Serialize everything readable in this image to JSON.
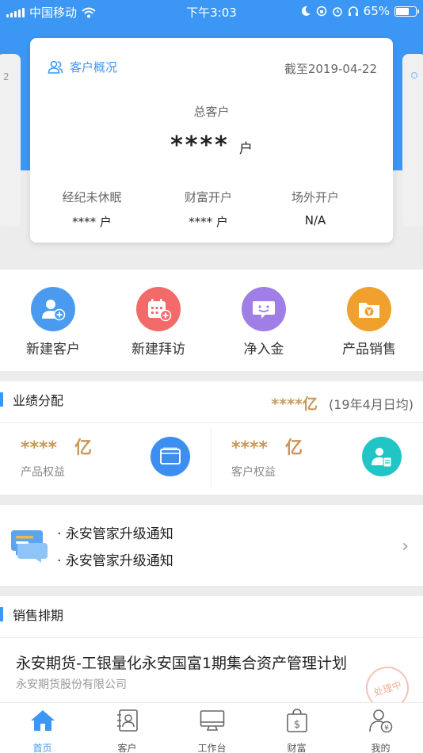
{
  "status_bar": {
    "carrier": "中国移动",
    "time": "下午3:03",
    "battery": "65%",
    "battery_level": 0.65
  },
  "side_cards": {
    "left_peek": "2"
  },
  "overview": {
    "title": "客户概况",
    "date": "截至2019-04-22",
    "total_label": "总客户",
    "total_value": "****",
    "total_unit": "户",
    "stats": [
      {
        "label": "经纪未休眠",
        "value": "**** 户"
      },
      {
        "label": "财富开户",
        "value": "**** 户"
      },
      {
        "label": "场外开户",
        "value": "N/A"
      }
    ]
  },
  "quick_actions": [
    {
      "label": "新建客户",
      "icon": "add-user-icon",
      "color": "#4a9bf0"
    },
    {
      "label": "新建拜访",
      "icon": "calendar-add-icon",
      "color": "#f26a6a"
    },
    {
      "label": "净入金",
      "icon": "message-smile-icon",
      "color": "#9f7ee6"
    },
    {
      "label": "产品销售",
      "icon": "product-folder-icon",
      "color": "#f0a02c"
    }
  ],
  "performance": {
    "title": "业绩分配",
    "total_value": "****亿",
    "total_note": "(19年4月日均)",
    "items": [
      {
        "value": "****",
        "unit": "亿",
        "label": "产品权益",
        "icon": "wallet-icon",
        "color": "#3c8ff0"
      },
      {
        "value": "****",
        "unit": "亿",
        "label": "客户权益",
        "icon": "customer-card-icon",
        "color": "#22c5c5"
      }
    ]
  },
  "notices": {
    "items": [
      "· 永安管家升级通知",
      "· 永安管家升级通知"
    ]
  },
  "sales": {
    "title": "销售排期",
    "product_name": "永安期货-工银量化永安国富1期集合资产管理计划",
    "company": "永安期货股份有限公司",
    "status": "处理中"
  },
  "tabbar": [
    {
      "label": "首页",
      "icon": "home-icon",
      "active": true
    },
    {
      "label": "客户",
      "icon": "contacts-icon",
      "active": false
    },
    {
      "label": "工作台",
      "icon": "monitor-icon",
      "active": false
    },
    {
      "label": "财富",
      "icon": "wealth-bag-icon",
      "active": false
    },
    {
      "label": "我的",
      "icon": "profile-icon",
      "active": false
    }
  ],
  "colors": {
    "brand_blue": "#3c97f4",
    "gold": "#c8975a"
  }
}
